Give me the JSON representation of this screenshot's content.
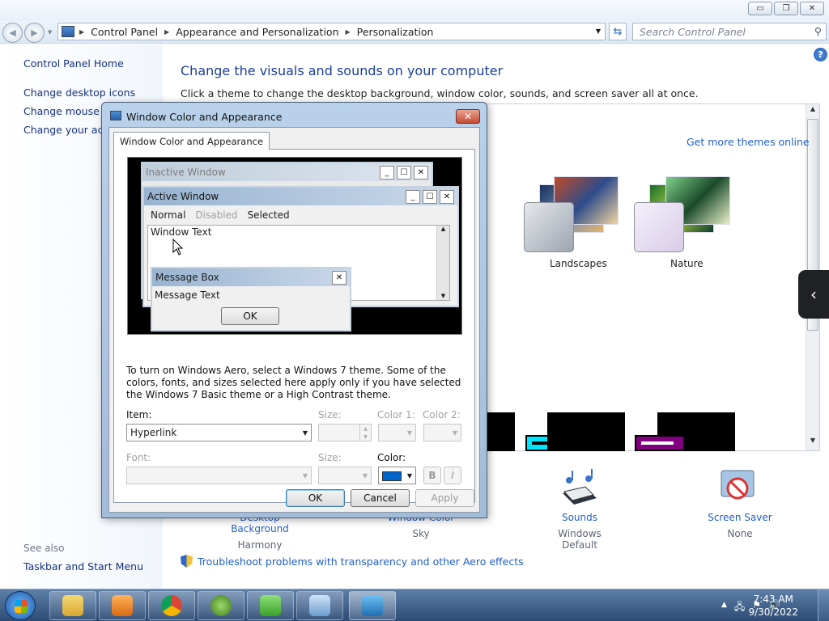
{
  "window": {
    "minimize": "▭",
    "restore": "❐",
    "close": "✕"
  },
  "address": {
    "crumbs": [
      "Control Panel",
      "Appearance and Personalization",
      "Personalization"
    ],
    "search_placeholder": "Search Control Panel"
  },
  "leftnav": {
    "home": "Control Panel Home",
    "items": [
      "Change desktop icons",
      "Change mouse po",
      "Change your acco"
    ],
    "see_also": "See also",
    "see_also_items": [
      "Taskbar and Start Menu"
    ]
  },
  "main": {
    "title": "Change the visuals and sounds on your computer",
    "subtitle": "Click a theme to change the desktop background, window color, sounds, and screen saver all at once.",
    "get_more": "Get more themes online",
    "themes": [
      "Landscapes",
      "Nature"
    ],
    "help": "?"
  },
  "bottom": {
    "desktop_background": {
      "label": "Desktop Background",
      "value": "Harmony"
    },
    "window_color": {
      "label": "Window Color",
      "value": "Sky"
    },
    "sounds": {
      "label": "Sounds",
      "value": "Windows Default"
    },
    "screen_saver": {
      "label": "Screen Saver",
      "value": "None"
    },
    "troubleshoot": "Troubleshoot problems with transparency and other Aero effects"
  },
  "dialog": {
    "title": "Window Color and Appearance",
    "tab": "Window Color and Appearance",
    "close": "✕",
    "preview": {
      "inactive_window": "Inactive Window",
      "active_window": "Active Window",
      "menu": [
        "Normal",
        "Disabled",
        "Selected"
      ],
      "window_text": "Window Text",
      "message_box": "Message Box",
      "message_text": "Message Text",
      "ok": "OK"
    },
    "note": "To turn on Windows Aero, select a Windows 7 theme.  Some of the colors, fonts, and sizes selected here apply only if you have selected the Windows 7 Basic theme or a High Contrast theme.",
    "item_label": "Item:",
    "item_value": "Hyperlink",
    "size_label": "Size:",
    "color1_label": "Color 1:",
    "color2_label": "Color 2:",
    "font_label": "Font:",
    "font_size_label": "Size:",
    "color_label": "Color:",
    "color_value": "#0066cc",
    "bold": "B",
    "italic": "I",
    "ok": "OK",
    "cancel": "Cancel",
    "apply": "Apply"
  },
  "taskbar": {
    "apps": [
      "file-explorer-icon",
      "media-player-icon",
      "chrome-icon",
      "windows-icon",
      "greenshot-icon",
      "control-panel-icon",
      "personalization-icon"
    ],
    "tray": {
      "up_arrow": "▲",
      "network": "🖧",
      "flag": "⚑",
      "volume": "🔊"
    },
    "time": "7:43 AM",
    "date": "9/30/2022"
  }
}
